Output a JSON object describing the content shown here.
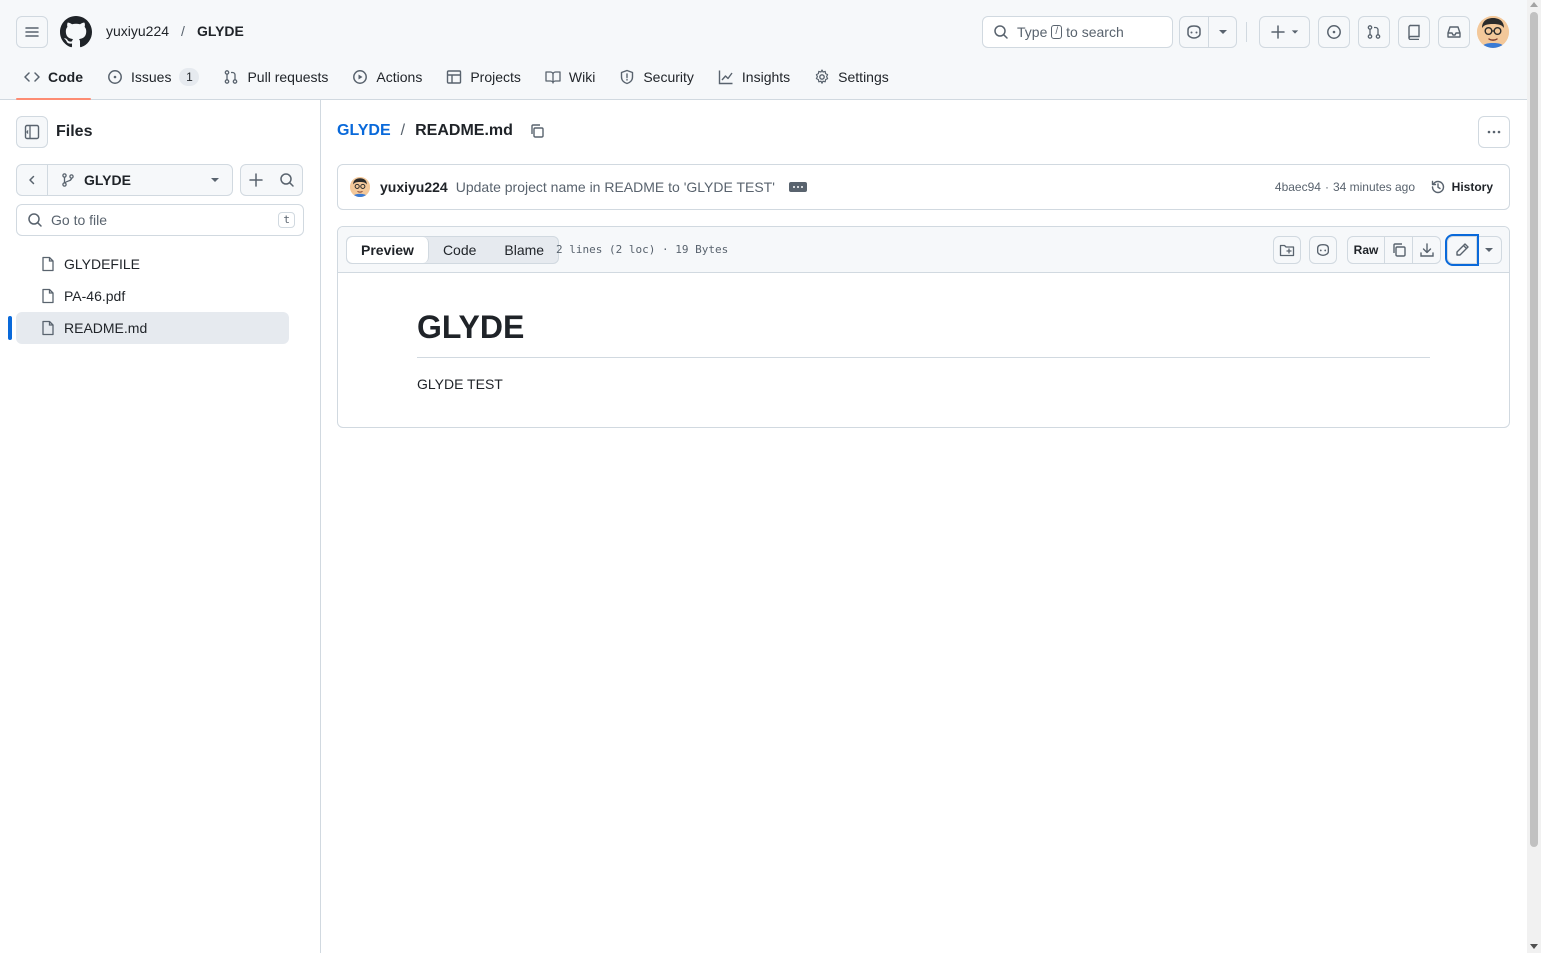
{
  "header": {
    "owner": "yuxiyu224",
    "separator": "/",
    "repo": "GLYDE",
    "search": {
      "prefix": "Type",
      "key": "/",
      "suffix": "to search"
    },
    "icons": [
      "hamburger-icon",
      "github-logo-icon",
      "copilot-icon",
      "plus-icon",
      "issue-icon",
      "pull-request-icon",
      "repo-icon",
      "inbox-icon"
    ]
  },
  "nav": {
    "code": "Code",
    "issues": "Issues",
    "issues_count": "1",
    "pull_requests": "Pull requests",
    "actions": "Actions",
    "projects": "Projects",
    "wiki": "Wiki",
    "security": "Security",
    "insights": "Insights",
    "settings": "Settings"
  },
  "sidebar": {
    "title": "Files",
    "branch": "GLYDE",
    "goto_placeholder": "Go to file",
    "goto_key": "t",
    "files": [
      {
        "name": "GLYDEFILE",
        "selected": false
      },
      {
        "name": "PA-46.pdf",
        "selected": false
      },
      {
        "name": "README.md",
        "selected": true
      }
    ]
  },
  "breadcrumb": {
    "root": "GLYDE",
    "separator": "/",
    "file": "README.md"
  },
  "commit": {
    "author": "yuxiyu224",
    "message": "Update project name in README to 'GLYDE TEST'",
    "sha": "4baec94",
    "dot": "·",
    "time": "34 minutes ago",
    "history": "History"
  },
  "file": {
    "tabs": {
      "preview": "Preview",
      "code": "Code",
      "blame": "Blame"
    },
    "info": "2 lines (2 loc) · 19 Bytes",
    "raw": "Raw"
  },
  "content": {
    "heading": "GLYDE",
    "paragraph": "GLYDE TEST"
  },
  "colors": {
    "link": "#0969da",
    "nav_underline": "#fd8c73",
    "border": "#d1d9e0",
    "muted": "#59636e"
  }
}
